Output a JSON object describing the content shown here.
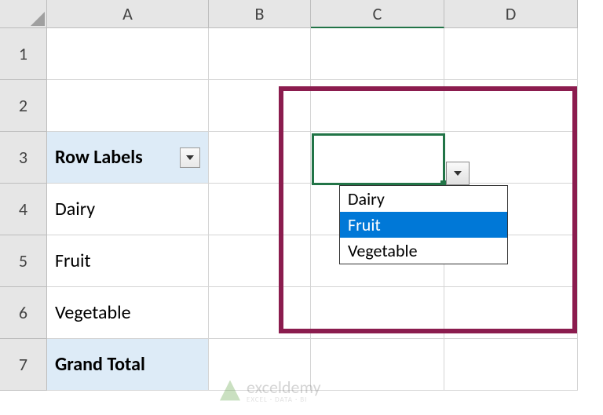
{
  "columns": [
    "A",
    "B",
    "C",
    "D"
  ],
  "rows": [
    "1",
    "2",
    "3",
    "4",
    "5",
    "6",
    "7"
  ],
  "pivot": {
    "header": "Row Labels",
    "items": [
      "Dairy",
      "Fruit",
      "Vegetable"
    ],
    "total": "Grand Total"
  },
  "dropdown": {
    "options": [
      "Dairy",
      "Fruit",
      "Vegetable"
    ],
    "selected_index": 1
  },
  "watermark": {
    "brand": "exceldemy",
    "tagline": "EXCEL · DATA · BI"
  }
}
